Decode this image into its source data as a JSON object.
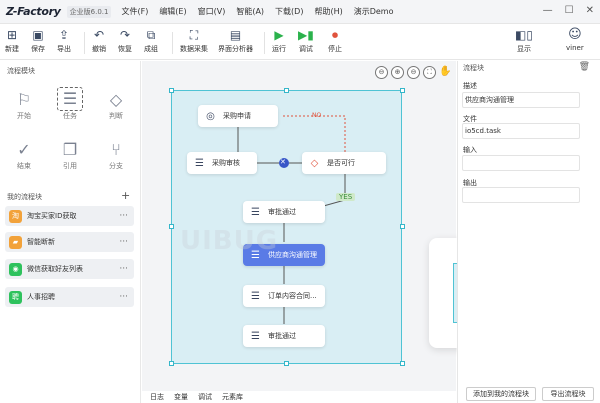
{
  "app": {
    "logo": "Z-Factory",
    "edition": "企业版6.0.1",
    "menu": [
      "文件(F)",
      "编辑(E)",
      "窗口(V)",
      "智能(A)",
      "下载(D)",
      "帮助(H)",
      "演示Demo"
    ]
  },
  "toolbar": {
    "new": "新建",
    "save": "保存",
    "export": "导出",
    "undo": "撤销",
    "redo": "恢复",
    "group": "成组",
    "data_collect": "数据采集",
    "ui_analyzer": "界面分析器",
    "run": "运行",
    "debug": "调试",
    "stop": "停止",
    "display": "显示",
    "user": "viner"
  },
  "left": {
    "modules_title": "流程模块",
    "modules": [
      "开始",
      "任务",
      "判断",
      "结束",
      "引用",
      "分支"
    ],
    "my_title": "我的流程块",
    "add": "+",
    "items": [
      {
        "label": "淘宝买家ID获取",
        "color": "#f2a23a"
      },
      {
        "label": "智能断新",
        "color": "#f2a23a"
      },
      {
        "label": "微信获取好友列表",
        "color": "#2ec25d"
      },
      {
        "label": "人事招聘",
        "color": "#2ec25d"
      }
    ],
    "more": "···"
  },
  "canvas": {
    "nodes": {
      "n1": "采购申请",
      "n2": "采购审核",
      "n3": "是否可行",
      "n4": "审批通过",
      "n5": "供应商沟通管理",
      "n6": "订单内容合同...",
      "n7": "审批通过"
    },
    "no_label": "NO",
    "yes_label": "YES",
    "tabs": [
      "日志",
      "变量",
      "调试",
      "元素库"
    ],
    "watermark": "UIBUG"
  },
  "right": {
    "title": "流程块",
    "desc_label": "描述",
    "desc_value": "供应商沟通管理",
    "file_label": "文件",
    "file_value": "io5cd.task",
    "input_label": "输入",
    "input_value": "",
    "output_label": "输出",
    "output_value": "",
    "add_btn": "添加到我的流程块",
    "export_btn": "导出流程块"
  },
  "preview": {
    "node": "任务"
  },
  "colors": {
    "accent": "#5a7be6",
    "selection": "#4fc3d4",
    "no": "#e0533d",
    "yes": "#4caf50"
  }
}
